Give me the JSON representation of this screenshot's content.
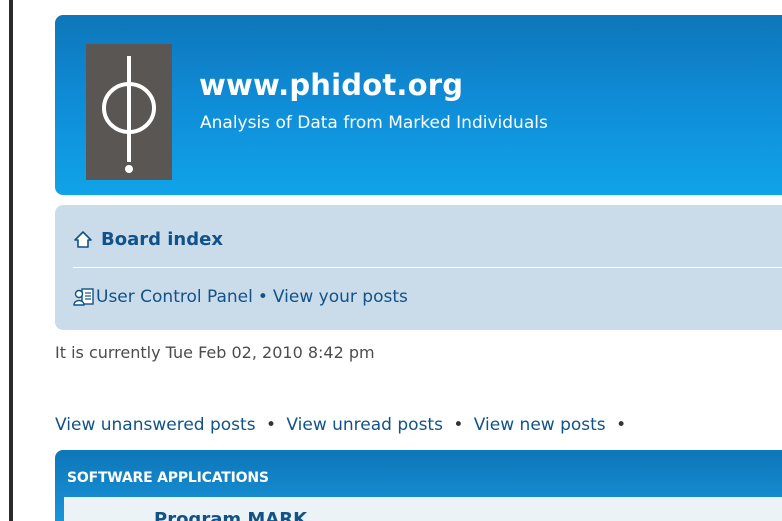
{
  "header": {
    "site_title": "www.phidot.org",
    "site_description": "Analysis of Data from Marked Individuals",
    "logo_icon": "phi-logo-icon",
    "gradient_top": "#0e76b9",
    "gradient_bottom": "#10a3e8"
  },
  "navbar": {
    "board_index": "Board index",
    "home_icon": "home-icon",
    "ucp_icon": "user-card-icon",
    "ucp": "User Control Panel",
    "separator": "•",
    "view_your_posts": "View your posts",
    "background": "#cadcea",
    "link_color": "#105289"
  },
  "status": {
    "current_time": "It is currently Tue Feb 02, 2010 8:42 pm"
  },
  "quick_links": {
    "unanswered": "View unanswered posts",
    "unread": "View unread posts",
    "new": "View new posts",
    "separator": "•"
  },
  "forum": {
    "category_header": "SOFTWARE APPLICATIONS",
    "first_forum": "Program MARK"
  }
}
